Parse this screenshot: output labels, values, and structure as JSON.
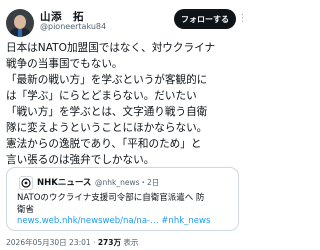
{
  "profile": {
    "name": "山添　拓",
    "handle": "@pioneertaku84"
  },
  "actions": {
    "follow_label": "フォローする"
  },
  "tweet": {
    "lines": [
      "日本はNATO加盟国ではなく、対ウクライナ",
      "戦争の当事国でもない。",
      "「最新の戦い方」を学ぶというが客観的に",
      "は「学ぶ」にらとどまらない。だいたい",
      "「戦い方」を学ぶとは、文字通り戦う自衛",
      "隊に変えようということにほかならない。",
      "憲法からの逸脱であり、「平和のため」と",
      "言い張るのは強弁でしかない。"
    ]
  },
  "quote": {
    "source_name": "NHKニュース",
    "source_handle": "@nhk_news",
    "source_date": "・2日",
    "text_line1": "NATOのウクライナ支援司令部に自衛官派遣へ 防",
    "text_line2": "衛省",
    "link": "news.web.nhk/newsweb/na/na-…",
    "hashtag": " #nhk_news"
  },
  "footer": {
    "timestamp": "2026年05月30日 23:01",
    "separator": " · ",
    "views_count": "273万",
    "views_label": " 表示"
  },
  "colors": {
    "accent": "#1d9bf0",
    "text": "#0f1419",
    "muted": "#536471"
  }
}
